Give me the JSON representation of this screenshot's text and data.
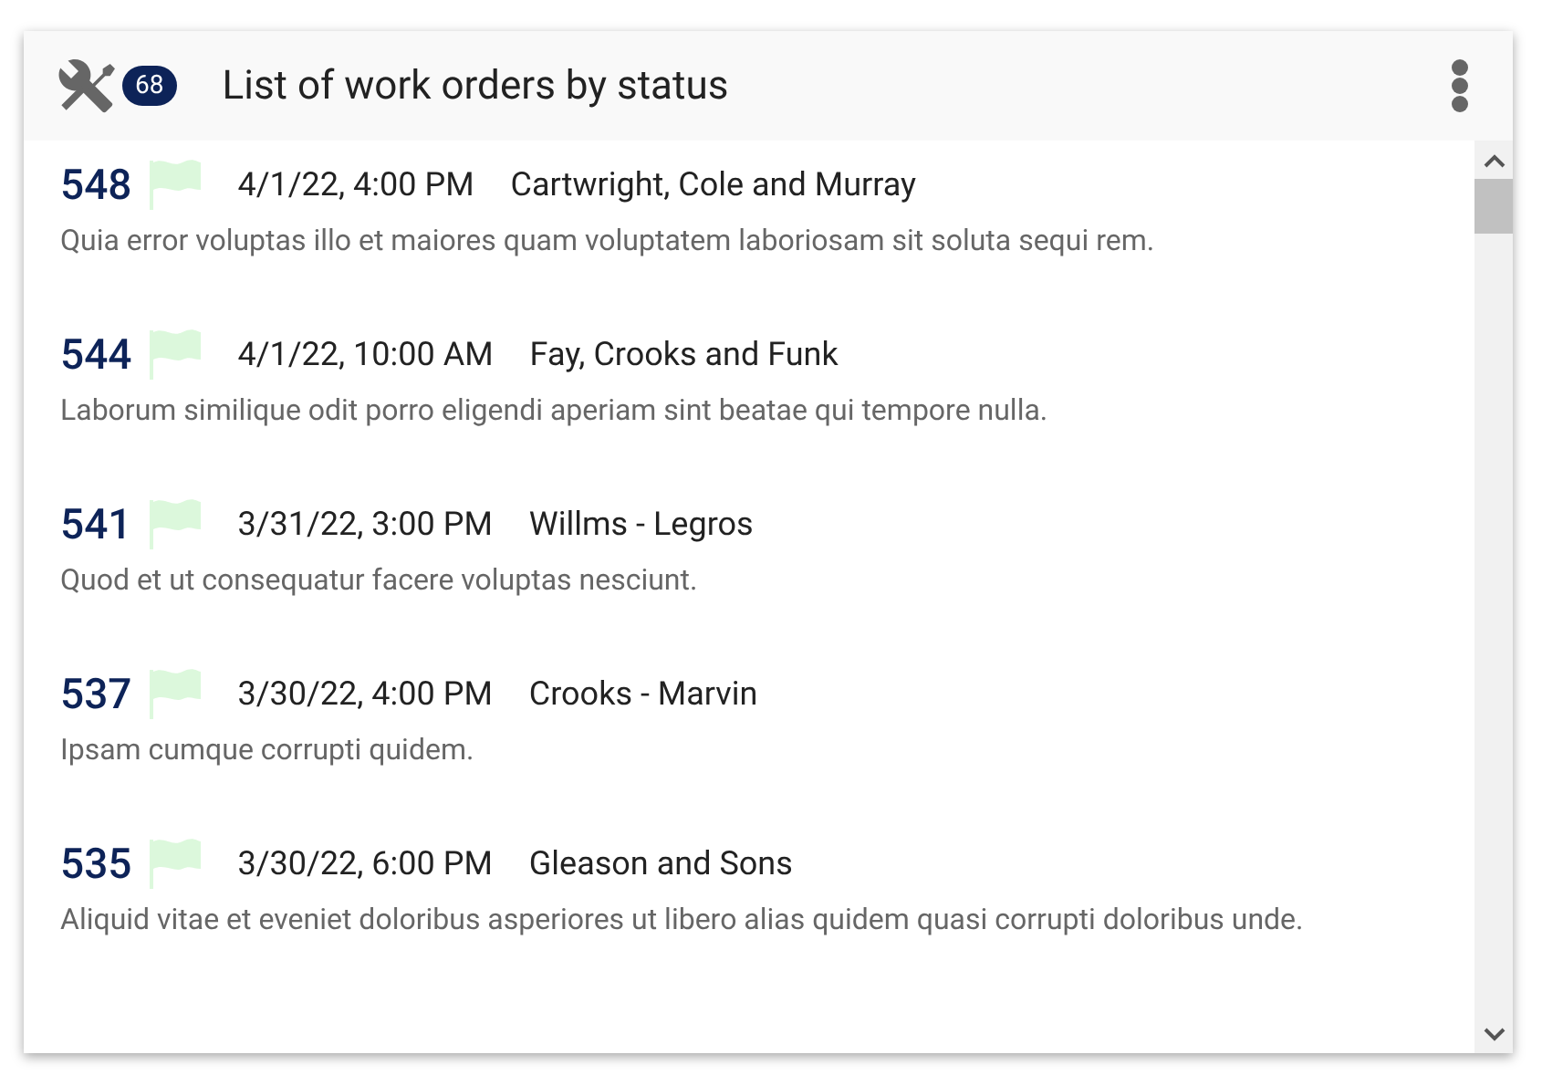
{
  "header": {
    "count": "68",
    "title": "List of work orders by status"
  },
  "orders": [
    {
      "number": "548",
      "date": "4/1/22, 4:00 PM",
      "company": "Cartwright, Cole and Murray",
      "description": "Quia error voluptas illo et maiores quam voluptatem laboriosam sit soluta sequi rem."
    },
    {
      "number": "544",
      "date": "4/1/22, 10:00 AM",
      "company": "Fay, Crooks and Funk",
      "description": "Laborum similique odit porro eligendi aperiam sint beatae qui tempore nulla."
    },
    {
      "number": "541",
      "date": "3/31/22, 3:00 PM",
      "company": "Willms - Legros",
      "description": "Quod et ut consequatur facere voluptas nesciunt."
    },
    {
      "number": "537",
      "date": "3/30/22, 4:00 PM",
      "company": "Crooks - Marvin",
      "description": "Ipsam cumque corrupti quidem."
    },
    {
      "number": "535",
      "date": "3/30/22, 6:00 PM",
      "company": "Gleason and Sons",
      "description": "Aliquid vitae et eveniet doloribus asperiores ut libero alias quidem quasi corrupti doloribus unde."
    }
  ]
}
